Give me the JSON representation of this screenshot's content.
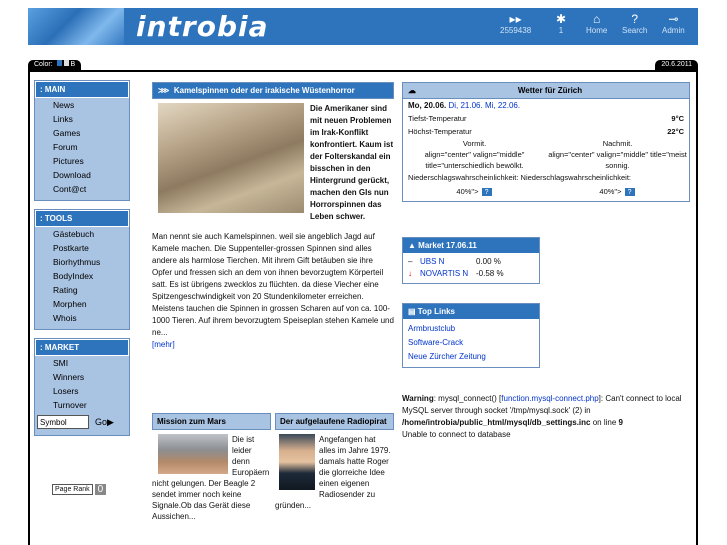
{
  "header": {
    "logo_text": "introbia",
    "nav": [
      {
        "label": "2559438",
        "icon": "arrows-icon"
      },
      {
        "label": "1",
        "icon": "person-icon"
      },
      {
        "label": "Home",
        "icon": "home-icon"
      },
      {
        "label": "Search",
        "icon": "question-icon"
      },
      {
        "label": "Admin",
        "icon": "key-icon"
      }
    ]
  },
  "topbar": {
    "color_label": "Color:",
    "color_opt_b": "B",
    "date": "20.6.2011"
  },
  "sidebar": {
    "main": {
      "title": ": MAIN",
      "items": [
        "News",
        "Links",
        "Games",
        "Forum",
        "Pictures",
        "Download",
        "Cont@ct"
      ]
    },
    "tools": {
      "title": ": TOOLS",
      "items": [
        "Gästebuch",
        "Postkarte",
        "Biorhythmus",
        "BodyIndex",
        "Rating",
        "Morphen",
        "Whois"
      ]
    },
    "market": {
      "title": ": MARKET",
      "items": [
        "SMI",
        "Winners",
        "Losers",
        "Turnover"
      ]
    },
    "symbol_value": "Symbol",
    "go_label": "Go",
    "pagerank_label": "Page Rank",
    "pagerank_value": "0"
  },
  "article": {
    "title": "Kamelspinnen oder der irakische Wüstenhorror",
    "lead": "Die Amerikaner sind mit neuen Problemen im Irak-Konflikt konfrontiert. Kaum ist der Folterskandal ein bisschen in den Hintergrund gerückt, machen den GIs nun Horrorspinnen das Leben schwer.",
    "body": "Man nennt sie auch Kamelspinnen. weil sie angeblich Jagd auf Kamele machen. Die Suppenteller-grossen Spinnen sind alles andere als harmlose Tierchen. Mit ihrem Gift betäuben sie ihre Opfer und fressen sich an dem von ihnen bevorzugtem Körperteil satt. Es ist übrigens zwecklos zu flüchten. da diese Viecher eine Spitzengeschwindigkeit von 20 Stundenkilometer erreichen. Meistens tauchen die Spinnen in grossen Scharen auf von ca. 100-1000 Tieren. Auf ihrem bevorzugtem Speiseplan stehen Kamele und ne...",
    "more": "[mehr]"
  },
  "mars": {
    "title": "Mission zum Mars",
    "text": "Die ist leider denn Europäern nicht gelungen. Der Beagle 2 sendet immer noch keine Signale.Ob das Gerät diese Aussichen..."
  },
  "pirat": {
    "title": "Der aufgelaufene Radiopirat",
    "text": "Angefangen hat alles im Jahre 1979. damals hatte Roger die glorreiche Idee einen eigenen Radiosender zu gründen..."
  },
  "weather": {
    "title": "Wetter für Zürich",
    "day_current": "Mo, 20.06.",
    "day_links": "Di, 21.06. Mi, 22.06.",
    "min_label": "Tiefst-Temperatur",
    "min_value": "9°C",
    "max_label": "Höchst-Temperatur",
    "max_value": "22°C",
    "col1_title": "Vormit.",
    "col2_title": "Nachmit.",
    "col1_desc": "align=\"center\" valign=\"middle\" title=\"unterschiedlich bewölkt.",
    "col2_desc": "align=\"center\" valign=\"middle\" title=\"meist sonnig.",
    "rain_label": "Niederschlagswahrscheinlichkeit: Niederschlagswahrscheinlichkeit:",
    "rain1": "40%\">",
    "rain2": "40%\">"
  },
  "market": {
    "title": "Market 17.06.11",
    "rows": [
      {
        "symbol": "UBS N",
        "change": "0.00 %",
        "trend": "flat"
      },
      {
        "symbol": "NOVARTIS N",
        "change": "-0.58 %",
        "trend": "down"
      }
    ]
  },
  "toplinks": {
    "title": "Top Links",
    "links": [
      "Armbrustclub",
      "Software-Crack",
      "Neue Zürcher Zeitung"
    ]
  },
  "warning": {
    "label": "Warning",
    "pre": ": mysql_connect() [",
    "link": "function.mysql-connect.php",
    "post": "]: Can't connect to local MySQL server through socket '/tmp/mysql.sock' (2) in",
    "path": "/home/introbia/public_html/mysql/db_settings.inc",
    "line_text": "on line",
    "line_num": "9",
    "tail": "Unable to connect to database"
  }
}
